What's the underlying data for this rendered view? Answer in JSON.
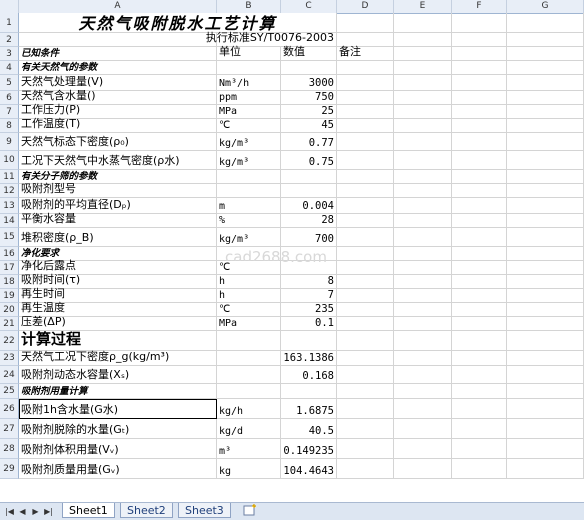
{
  "columns": [
    "A",
    "B",
    "C",
    "D",
    "E",
    "F",
    "G"
  ],
  "rows": [
    {
      "n": "1",
      "h": 20,
      "cells": [
        {
          "c": "A",
          "t": "天然气吸附脱水工艺计算",
          "k": "title",
          "span": 3
        }
      ]
    },
    {
      "n": "2",
      "h": 14,
      "cells": [
        {
          "c": "B",
          "t": "执行标准SY/T0076-2003",
          "k": "std",
          "span": 2
        }
      ]
    },
    {
      "n": "3",
      "h": 14,
      "cells": [
        {
          "c": "A",
          "t": "已知条件",
          "k": "section"
        },
        {
          "c": "B",
          "t": "单位"
        },
        {
          "c": "C",
          "t": "数值"
        },
        {
          "c": "D",
          "t": "备注"
        }
      ]
    },
    {
      "n": "4",
      "h": 14,
      "cells": [
        {
          "c": "A",
          "t": "有关天然气的参数",
          "k": "section"
        }
      ]
    },
    {
      "n": "5",
      "h": 16,
      "cells": [
        {
          "c": "A",
          "t": "天然气处理量(V)"
        },
        {
          "c": "B",
          "t": "Nm³/h",
          "k": "unit"
        },
        {
          "c": "C",
          "t": "3000",
          "k": "num"
        }
      ]
    },
    {
      "n": "6",
      "h": 14,
      "cells": [
        {
          "c": "A",
          "t": "天然气含水量()"
        },
        {
          "c": "B",
          "t": "ppm",
          "k": "unit"
        },
        {
          "c": "C",
          "t": "750",
          "k": "num"
        }
      ]
    },
    {
      "n": "7",
      "h": 14,
      "cells": [
        {
          "c": "A",
          "t": "工作压力(P)"
        },
        {
          "c": "B",
          "t": "MPa",
          "k": "unit"
        },
        {
          "c": "C",
          "t": "25",
          "k": "num"
        }
      ]
    },
    {
      "n": "8",
      "h": 14,
      "cells": [
        {
          "c": "A",
          "t": "工作温度(T)"
        },
        {
          "c": "B",
          "t": "℃",
          "k": "unit"
        },
        {
          "c": "C",
          "t": "45",
          "k": "num"
        }
      ]
    },
    {
      "n": "9",
      "h": 18,
      "cells": [
        {
          "c": "A",
          "t": "天然气标态下密度(ρ₀)"
        },
        {
          "c": "B",
          "t": "kg/m³",
          "k": "unit"
        },
        {
          "c": "C",
          "t": "0.77",
          "k": "num"
        }
      ]
    },
    {
      "n": "10",
      "h": 19,
      "cells": [
        {
          "c": "A",
          "t": "工况下天然气中水蒸气密度(ρ水)"
        },
        {
          "c": "B",
          "t": "kg/m³",
          "k": "unit"
        },
        {
          "c": "C",
          "t": "0.75",
          "k": "num"
        }
      ]
    },
    {
      "n": "11",
      "h": 14,
      "cells": [
        {
          "c": "A",
          "t": "有关分子筛的参数",
          "k": "section"
        }
      ]
    },
    {
      "n": "12",
      "h": 14,
      "cells": [
        {
          "c": "A",
          "t": "吸附剂型号"
        }
      ]
    },
    {
      "n": "13",
      "h": 16,
      "cells": [
        {
          "c": "A",
          "t": "吸附剂的平均直径(Dₚ)"
        },
        {
          "c": "B",
          "t": "m",
          "k": "unit"
        },
        {
          "c": "C",
          "t": "0.004",
          "k": "num"
        }
      ]
    },
    {
      "n": "14",
      "h": 14,
      "cells": [
        {
          "c": "A",
          "t": "平衡水容量"
        },
        {
          "c": "B",
          "t": "%",
          "k": "unit"
        },
        {
          "c": "C",
          "t": "28",
          "k": "num"
        }
      ]
    },
    {
      "n": "15",
      "h": 19,
      "cells": [
        {
          "c": "A",
          "t": "堆积密度(ρ_B)"
        },
        {
          "c": "B",
          "t": "kg/m³",
          "k": "unit"
        },
        {
          "c": "C",
          "t": "700",
          "k": "num"
        }
      ]
    },
    {
      "n": "16",
      "h": 14,
      "cells": [
        {
          "c": "A",
          "t": "净化要求",
          "k": "section"
        }
      ]
    },
    {
      "n": "17",
      "h": 14,
      "cells": [
        {
          "c": "A",
          "t": "净化后露点"
        },
        {
          "c": "B",
          "t": "℃",
          "k": "unit"
        }
      ]
    },
    {
      "n": "18",
      "h": 14,
      "cells": [
        {
          "c": "A",
          "t": "吸附时间(τ)"
        },
        {
          "c": "B",
          "t": "h",
          "k": "unit"
        },
        {
          "c": "C",
          "t": "8",
          "k": "num"
        }
      ]
    },
    {
      "n": "19",
      "h": 14,
      "cells": [
        {
          "c": "A",
          "t": "再生时间"
        },
        {
          "c": "B",
          "t": "h",
          "k": "unit"
        },
        {
          "c": "C",
          "t": "7",
          "k": "num"
        }
      ]
    },
    {
      "n": "20",
      "h": 14,
      "cells": [
        {
          "c": "A",
          "t": "再生温度"
        },
        {
          "c": "B",
          "t": "℃",
          "k": "unit"
        },
        {
          "c": "C",
          "t": "235",
          "k": "num"
        }
      ]
    },
    {
      "n": "21",
      "h": 14,
      "cells": [
        {
          "c": "A",
          "t": "压差(ΔP)"
        },
        {
          "c": "B",
          "t": "MPa",
          "k": "unit"
        },
        {
          "c": "C",
          "t": "0.1",
          "k": "num"
        }
      ]
    },
    {
      "n": "22",
      "h": 20,
      "cells": [
        {
          "c": "A",
          "t": "计算过程",
          "k": "big"
        }
      ]
    },
    {
      "n": "23",
      "h": 15,
      "cells": [
        {
          "c": "A",
          "t": "天然气工况下密度ρ_g(kg/m³)"
        },
        {
          "c": "C",
          "t": "163.1386",
          "k": "num"
        }
      ]
    },
    {
      "n": "24",
      "h": 18,
      "cells": [
        {
          "c": "A",
          "t": "吸附剂动态水容量(Xₛ)"
        },
        {
          "c": "C",
          "t": "0.168",
          "k": "num"
        }
      ]
    },
    {
      "n": "25",
      "h": 15,
      "cells": [
        {
          "c": "A",
          "t": "吸附剂用量计算",
          "k": "section"
        }
      ]
    },
    {
      "n": "26",
      "h": 20,
      "cells": [
        {
          "c": "A",
          "t": "吸附1h含水量(G水)",
          "k": "selected"
        },
        {
          "c": "B",
          "t": "kg/h",
          "k": "unit"
        },
        {
          "c": "C",
          "t": "1.6875",
          "k": "num"
        }
      ]
    },
    {
      "n": "27",
      "h": 20,
      "cells": [
        {
          "c": "A",
          "t": "吸附剂脱除的水量(Gₜ)"
        },
        {
          "c": "B",
          "t": "kg/d",
          "k": "unit"
        },
        {
          "c": "C",
          "t": "40.5",
          "k": "num"
        }
      ]
    },
    {
      "n": "28",
      "h": 20,
      "cells": [
        {
          "c": "A",
          "t": "吸附剂体积用量(Vᵥ)"
        },
        {
          "c": "B",
          "t": "m³",
          "k": "unit"
        },
        {
          "c": "C",
          "t": "0.149235",
          "k": "num"
        }
      ]
    },
    {
      "n": "29",
      "h": 20,
      "cells": [
        {
          "c": "A",
          "t": "吸附剂质量用量(Gᵥ)"
        },
        {
          "c": "B",
          "t": "kg",
          "k": "unit"
        },
        {
          "c": "C",
          "t": "104.4643",
          "k": "num"
        }
      ]
    }
  ],
  "watermark": "cad2688.com",
  "tabs": {
    "nav": [
      "|◀",
      "◀",
      "▶",
      "▶|"
    ],
    "sheets": [
      "Sheet1",
      "Sheet2",
      "Sheet3"
    ],
    "active": "Sheet1",
    "new_sheet_icon": "new-sheet-icon"
  }
}
